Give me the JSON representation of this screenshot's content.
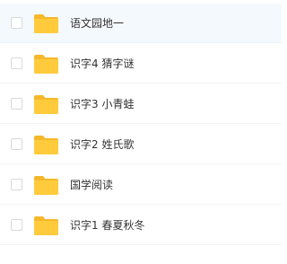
{
  "file_list": {
    "items": [
      {
        "name": "语文园地一",
        "highlighted": true
      },
      {
        "name": "识字4 猜字谜",
        "highlighted": false
      },
      {
        "name": "识字3 小青蛙",
        "highlighted": false
      },
      {
        "name": "识字2 姓氏歌",
        "highlighted": false
      },
      {
        "name": "国学阅读",
        "highlighted": false
      },
      {
        "name": "识字1 春夏秋冬",
        "highlighted": false
      }
    ],
    "icon": "folder-icon",
    "colors": {
      "folder": "#ffcb3d",
      "folder_tab": "#f5b82a",
      "highlight_bg": "#f4f9fe",
      "text": "#333333",
      "checkbox_border": "#d6d9de"
    }
  }
}
